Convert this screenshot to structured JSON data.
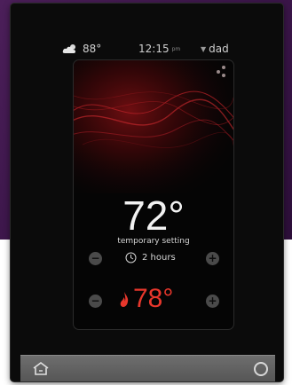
{
  "status_bar": {
    "weather_temp": "88°",
    "time": "12:15",
    "ampm": "pm",
    "user": "dad"
  },
  "thermostat": {
    "set_temperature": "72°",
    "mode_label": "temporary setting",
    "duration": "2 hours",
    "current_temperature": "78°"
  },
  "buttons": {
    "decrease": "−",
    "increase": "+"
  },
  "colors": {
    "accent_red": "#e8372c",
    "background_purple": "#4c1f5a"
  },
  "icons": [
    "cloud-sun-icon",
    "clock-icon",
    "flame-icon",
    "menu-dots-icon",
    "home-icon",
    "circle-icon"
  ]
}
